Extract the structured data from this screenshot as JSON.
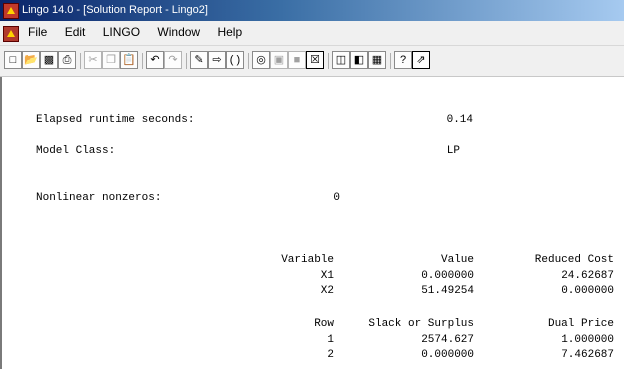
{
  "window": {
    "title": "Lingo 14.0 - [Solution Report - Lingo2]"
  },
  "menu": {
    "items": [
      "File",
      "Edit",
      "LINGO",
      "Window",
      "Help"
    ]
  },
  "report": {
    "elapsed_label": "Elapsed runtime seconds:",
    "elapsed_value": "0.14",
    "model_class_label": "Model Class:",
    "model_class_value": "LP",
    "nonlinear_label": "Nonlinear nonzeros:",
    "nonlinear_value": "0",
    "variables": {
      "headers": [
        "Variable",
        "Value",
        "Reduced Cost"
      ],
      "rows": [
        [
          "X1",
          "0.000000",
          "24.62687"
        ],
        [
          "X2",
          "51.49254",
          "0.000000"
        ]
      ]
    },
    "rows": {
      "headers": [
        "Row",
        "Slack or Surplus",
        "Dual Price"
      ],
      "rows": [
        [
          "1",
          "2574.627",
          "1.000000"
        ],
        [
          "2",
          "0.000000",
          "7.462687"
        ]
      ]
    }
  }
}
